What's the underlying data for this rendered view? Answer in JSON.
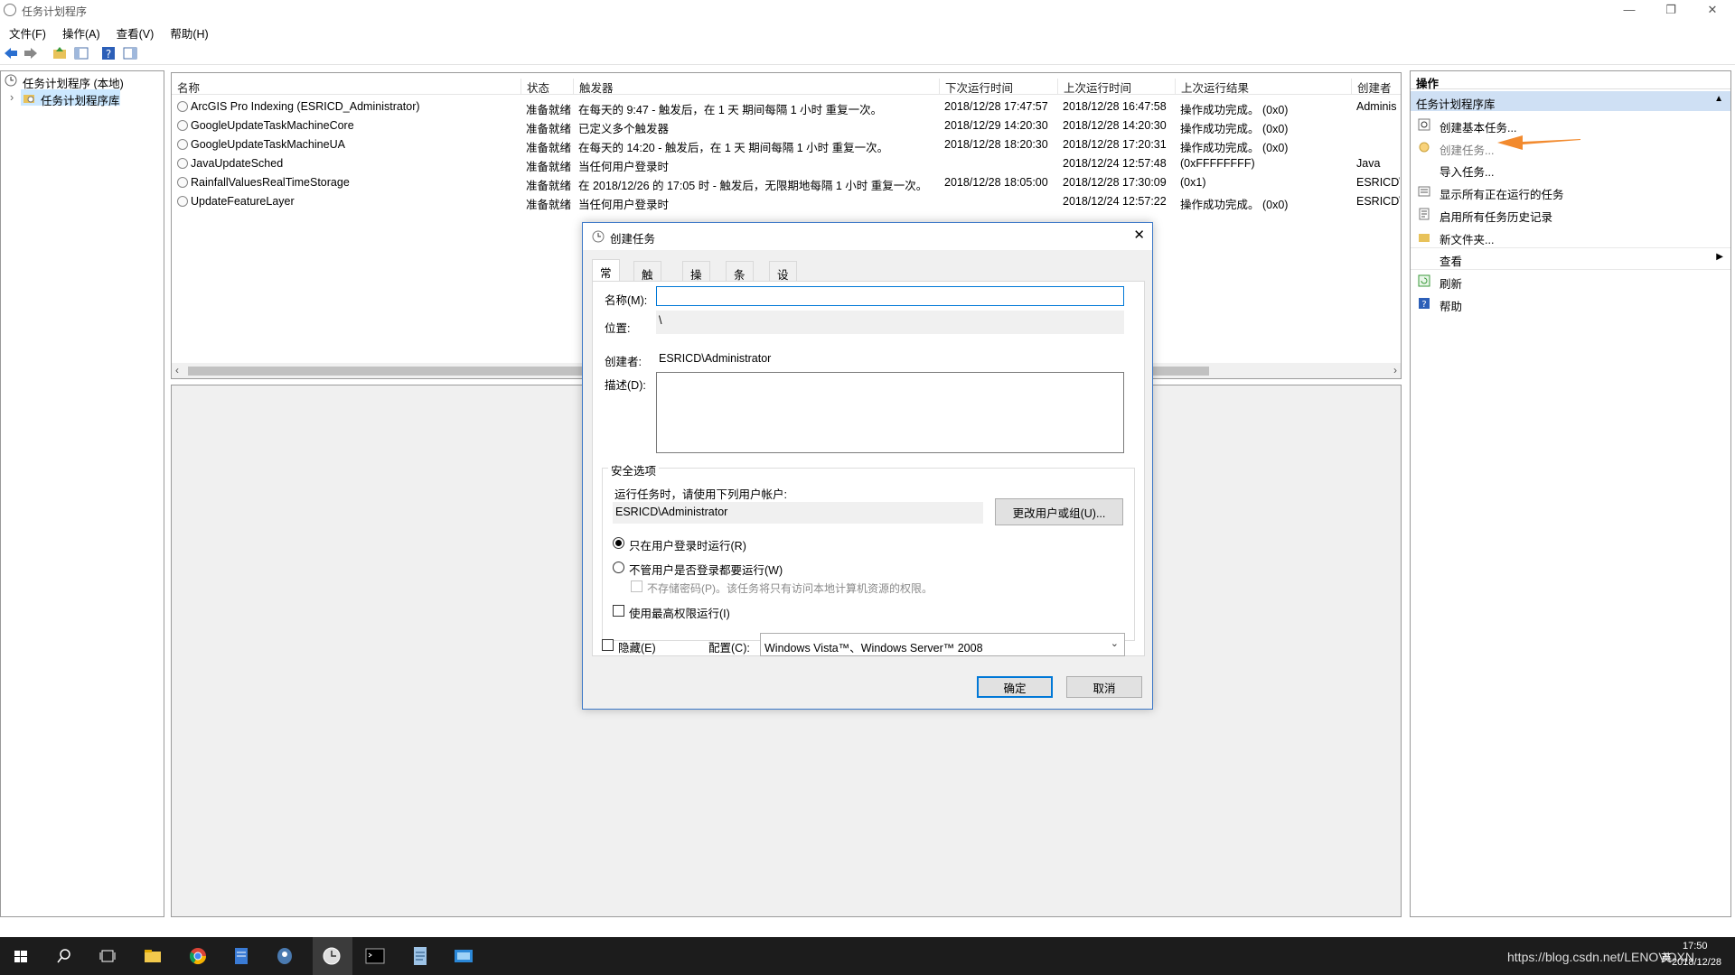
{
  "window": {
    "title": "任务计划程序",
    "min": "—",
    "max": "❐",
    "close": "✕"
  },
  "menu": [
    "文件(F)",
    "操作(A)",
    "查看(V)",
    "帮助(H)"
  ],
  "tree": {
    "root": "任务计划程序 (本地)",
    "child": "任务计划程序库"
  },
  "columns": [
    "名称",
    "状态",
    "触发器",
    "下次运行时间",
    "上次运行时间",
    "上次运行结果",
    "创建者"
  ],
  "tasks": [
    {
      "name": "ArcGIS Pro Indexing (ESRICD_Administrator)",
      "status": "准备就绪",
      "trigger": "在每天的 9:47 - 触发后，在 1 天 期间每隔 1 小时 重复一次。",
      "next": "2018/12/28 17:47:57",
      "last": "2018/12/28 16:47:58",
      "result": "操作成功完成。 (0x0)",
      "author": "Adminis"
    },
    {
      "name": "GoogleUpdateTaskMachineCore",
      "status": "准备就绪",
      "trigger": "已定义多个触发器",
      "next": "2018/12/29 14:20:30",
      "last": "2018/12/28 14:20:30",
      "result": "操作成功完成。 (0x0)",
      "author": ""
    },
    {
      "name": "GoogleUpdateTaskMachineUA",
      "status": "准备就绪",
      "trigger": "在每天的 14:20 - 触发后，在 1 天 期间每隔 1 小时 重复一次。",
      "next": "2018/12/28 18:20:30",
      "last": "2018/12/28 17:20:31",
      "result": "操作成功完成。 (0x0)",
      "author": ""
    },
    {
      "name": "JavaUpdateSched",
      "status": "准备就绪",
      "trigger": "当任何用户登录时",
      "next": "",
      "last": "2018/12/24 12:57:48",
      "result": "(0xFFFFFFFF)",
      "author": "Java"
    },
    {
      "name": "RainfallValuesRealTimeStorage",
      "status": "准备就绪",
      "trigger": "在 2018/12/26 的 17:05 时 - 触发后，无限期地每隔 1 小时 重复一次。",
      "next": "2018/12/28 18:05:00",
      "last": "2018/12/28 17:30:09",
      "result": "(0x1)",
      "author": "ESRICD\\"
    },
    {
      "name": "UpdateFeatureLayer",
      "status": "准备就绪",
      "trigger": "当任何用户登录时",
      "next": "",
      "last": "2018/12/24 12:57:22",
      "result": "操作成功完成。 (0x0)",
      "author": "ESRICD\\"
    }
  ],
  "actions": {
    "header": "操作",
    "section": "任务计划程序库",
    "items": [
      "创建基本任务...",
      "创建任务...",
      "导入任务...",
      "显示所有正在运行的任务",
      "启用所有任务历史记录",
      "新文件夹...",
      "查看",
      "刷新",
      "帮助"
    ]
  },
  "dialog": {
    "title": "创建任务",
    "tabs": [
      "常规",
      "触发器",
      "操作",
      "条件",
      "设置"
    ],
    "name_label": "名称(M):",
    "name_value": "",
    "location_label": "位置:",
    "location_value": "\\",
    "author_label": "创建者:",
    "author_value": "ESRICD\\Administrator",
    "desc_label": "描述(D):",
    "desc_value": "",
    "security_title": "安全选项",
    "run_as_label": "运行任务时，请使用下列用户帐户:",
    "run_as_value": "ESRICD\\Administrator",
    "change_user_button": "更改用户或组(U)...",
    "radio_logged_on": "只在用户登录时运行(R)",
    "radio_any": "不管用户是否登录都要运行(W)",
    "no_store_pw": "不存储密码(P)。该任务将只有访问本地计算机资源的权限。",
    "highest_priv": "使用最高权限运行(I)",
    "hidden": "隐藏(E)",
    "config_label": "配置(C):",
    "config_value": "Windows Vista™、Windows Server™ 2008",
    "ok": "确定",
    "cancel": "取消"
  },
  "taskbar": {
    "watermark": "https://blog.csdn.net/LENOVOXN",
    "time": "17:50",
    "date": "2018/12/28",
    "ime": "英"
  }
}
